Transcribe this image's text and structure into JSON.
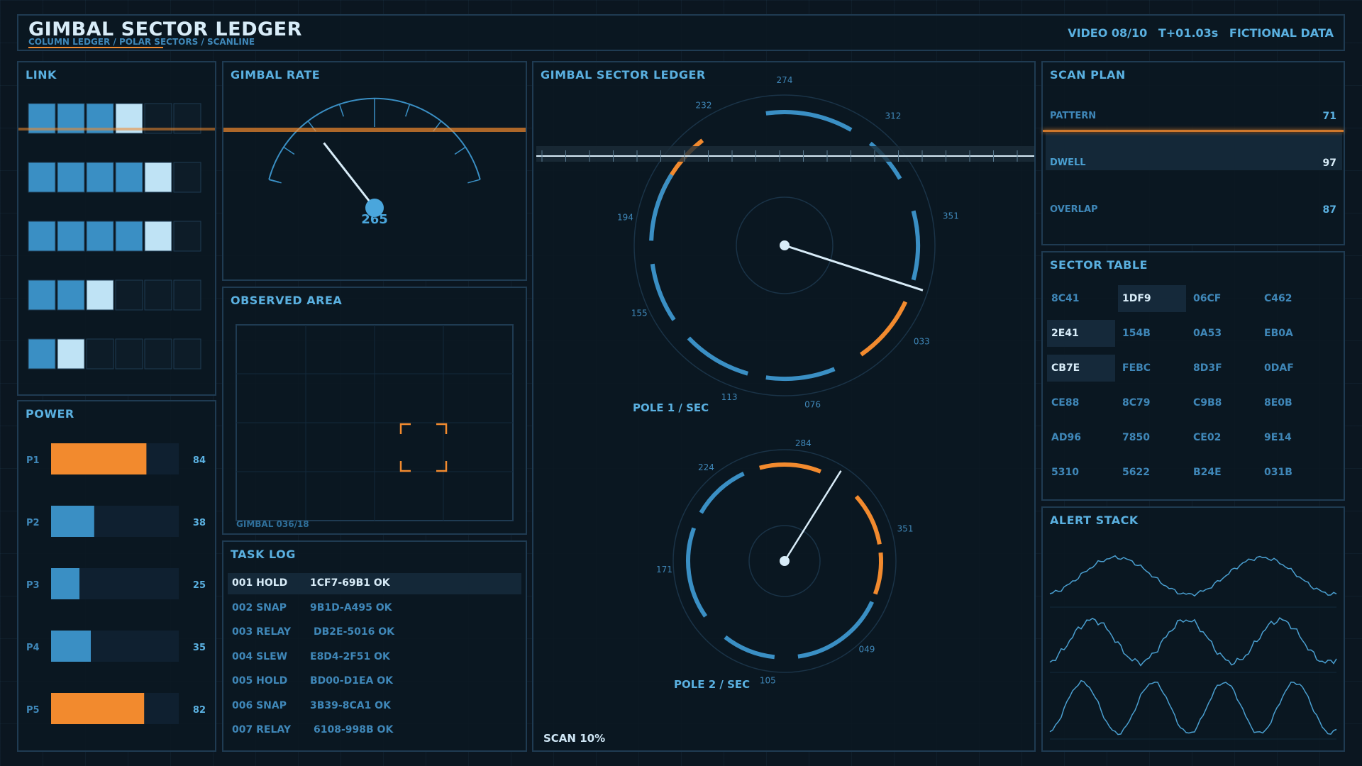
{
  "header": {
    "title": "GIMBAL SECTOR LEDGER",
    "subtitle": "COLUMN LEDGER / POLAR SECTORS / SCANLINE",
    "video": "VIDEO 08/10",
    "time": "T+01.03s",
    "data_note": "FICTIONAL DATA"
  },
  "link": {
    "title": "LINK",
    "rows": [
      [
        1,
        1,
        1,
        2,
        0,
        0
      ],
      [
        1,
        1,
        1,
        1,
        2,
        0
      ],
      [
        1,
        1,
        1,
        1,
        2,
        0
      ],
      [
        1,
        1,
        2,
        0,
        0,
        0
      ],
      [
        1,
        2,
        0,
        0,
        0,
        0
      ]
    ]
  },
  "power": {
    "title": "POWER",
    "bars": [
      {
        "label": "P1",
        "value": 84,
        "value_text": "84",
        "color": "#f28a2e"
      },
      {
        "label": "P2",
        "value": 38,
        "value_text": "38",
        "color": "#3a8fc4"
      },
      {
        "label": "P3",
        "value": 25,
        "value_text": "25",
        "color": "#3a8fc4"
      },
      {
        "label": "P4",
        "value": 35,
        "value_text": "35",
        "color": "#3a8fc4"
      },
      {
        "label": "P5",
        "value": 82,
        "value_text": "82",
        "color": "#f28a2e"
      }
    ]
  },
  "gimbal_rate": {
    "title": "GIMBAL RATE",
    "value": 265,
    "value_text": "265"
  },
  "observed_area": {
    "title": "OBSERVED AREA",
    "footer": "GIMBAL 036/18"
  },
  "task_log": {
    "title": "TASK LOG",
    "rows": [
      {
        "id": "001",
        "op": "HOLD",
        "code": "1CF7-69B1",
        "status": "OK"
      },
      {
        "id": "002",
        "op": "SNAP",
        "code": "9B1D-A495",
        "status": "OK"
      },
      {
        "id": "003",
        "op": "RELAY",
        "code": "DB2E-5016",
        "status": "OK"
      },
      {
        "id": "004",
        "op": "SLEW",
        "code": "E8D4-2F51",
        "status": "OK"
      },
      {
        "id": "005",
        "op": "HOLD",
        "code": "BD00-D1EA",
        "status": "OK"
      },
      {
        "id": "006",
        "op": "SNAP",
        "code": "3B39-8CA1",
        "status": "OK"
      },
      {
        "id": "007",
        "op": "RELAY",
        "code": "6108-998B",
        "status": "OK"
      }
    ]
  },
  "ledger": {
    "title": "GIMBAL SECTOR LEDGER",
    "scan": "SCAN 10%",
    "pole1": {
      "label": "POLE 1 / SEC",
      "ticks": [
        "274",
        "312",
        "351",
        "033",
        "076",
        "113",
        "155",
        "194",
        "232"
      ]
    },
    "pole2": {
      "label": "POLE 2 / SEC",
      "ticks": [
        "284",
        "351",
        "049",
        "105",
        "171",
        "224"
      ]
    }
  },
  "scan_plan": {
    "title": "SCAN PLAN",
    "rows": [
      {
        "label": "PATTERN",
        "value": "71"
      },
      {
        "label": "DWELL",
        "value": "97"
      },
      {
        "label": "OVERLAP",
        "value": "87"
      }
    ]
  },
  "sector_table": {
    "title": "SECTOR TABLE",
    "cells": [
      [
        "8C41",
        "1DF9",
        "06CF",
        "C462"
      ],
      [
        "2E41",
        "154B",
        "0A53",
        "EB0A"
      ],
      [
        "CB7E",
        "FEBC",
        "8D3F",
        "0DAF"
      ],
      [
        "CE88",
        "8C79",
        "C9B8",
        "8E0B"
      ],
      [
        "AD96",
        "7850",
        "CE02",
        "9E14"
      ],
      [
        "5310",
        "5622",
        "B24E",
        "031B"
      ]
    ]
  },
  "alert_stack": {
    "title": "ALERT STACK"
  },
  "colors": {
    "accent": "#3a8fc4",
    "orange": "#f28a2e",
    "light": "#bfe3f5",
    "text": "#5ab0e0"
  }
}
